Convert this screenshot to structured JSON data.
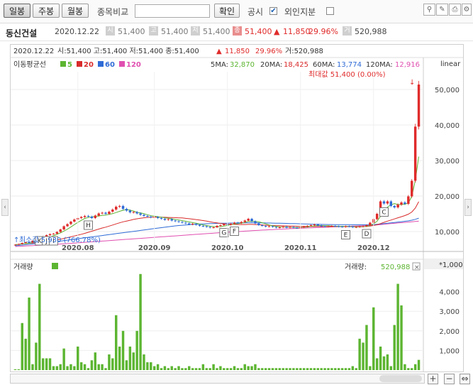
{
  "toolbar": {
    "day": "일봉",
    "week": "주봉",
    "month": "월봉",
    "compare_label": "종목비교",
    "compare_value": "",
    "confirm": "확인",
    "disclosure": "공시",
    "disclosure_check": "✔",
    "foreign": "외인지분",
    "foreign_check": ""
  },
  "info": {
    "name": "동신건설",
    "date": "2020.12.22",
    "open_icon": "시",
    "open": "51,400",
    "high_icon": "고",
    "high": "51,400",
    "low_icon": "저",
    "low": "51,400",
    "close_icon": "종",
    "close": "51,400",
    "change_arrow": "▲",
    "change": "11,850",
    "change_pct": "29.96%",
    "vol_icon": "거",
    "volume": "520,988"
  },
  "chart_header": {
    "date": "2020.12.22",
    "ohlc_text": "시:51,400  고:51,400  저:51,400  종:51,400",
    "arrow": "▲",
    "change": "11,850",
    "pct": "29.96%",
    "vol_text": "거:520,988"
  },
  "ma_legend": {
    "title": "이동평균선",
    "items": [
      {
        "label": "5",
        "color": "#5cb531"
      },
      {
        "label": "20",
        "color": "#d92b2b"
      },
      {
        "label": "60",
        "color": "#2f6bd6"
      },
      {
        "label": "120",
        "color": "#e04fb0"
      }
    ]
  },
  "ma_values": {
    "ma5_label": "5MA:",
    "ma5": "32,870",
    "ma20_label": "20MA:",
    "ma20": "18,425",
    "ma60_label": "60MA:",
    "ma60": "13,774",
    "ma120_label": "120MA:",
    "ma120": "12,916"
  },
  "scale_label": "linear",
  "max_label": "최대값 51,400 (0.00%)",
  "min_label": "최소값 5,930 (766.78%)",
  "volume_panel": {
    "title": "거래량",
    "value_label": "거래량:",
    "value": "520,988",
    "unit": "*1,000",
    "close": "×"
  },
  "colors": {
    "up": "#e02b2b",
    "down": "#2f6bd6",
    "volume": "#5cb531",
    "ma5": "#5cb531",
    "ma20": "#d92b2b",
    "ma60": "#2f6bd6",
    "ma120": "#e04fb0"
  },
  "chart_data": [
    {
      "type": "candlestick",
      "ylim": [
        5000,
        55000
      ],
      "yticks": [
        "10,000",
        "20,000",
        "30,000",
        "40,000",
        "50,000"
      ],
      "ytick_values": [
        10000,
        20000,
        30000,
        40000,
        50000
      ],
      "xticks": [
        "2020.08",
        "2020.09",
        "2020.10",
        "2020.11",
        "2020.12"
      ],
      "xtick_index": [
        18,
        40,
        61,
        82,
        103
      ],
      "events": [
        {
          "label": "K",
          "index": 7
        },
        {
          "label": "J",
          "index": 9
        },
        {
          "label": "I",
          "index": 11
        },
        {
          "label": "H",
          "index": 21
        },
        {
          "label": "G",
          "index": 60
        },
        {
          "label": "F",
          "index": 63
        },
        {
          "label": "E",
          "index": 95
        },
        {
          "label": "D",
          "index": 101
        },
        {
          "label": "C",
          "index": 106
        }
      ],
      "close": [
        6300,
        6500,
        6800,
        7000,
        6900,
        7400,
        7800,
        8200,
        8600,
        9000,
        9300,
        9400,
        9900,
        10600,
        11500,
        12100,
        12800,
        13400,
        13800,
        14100,
        14400,
        14200,
        13800,
        14500,
        15100,
        15300,
        15000,
        15600,
        16200,
        17000,
        17200,
        16400,
        15900,
        15400,
        15500,
        15100,
        14700,
        14400,
        14200,
        14000,
        14100,
        13800,
        13600,
        13300,
        13500,
        13100,
        12900,
        12700,
        12500,
        12300,
        12000,
        12200,
        11900,
        11600,
        11500,
        11300,
        11100,
        11200,
        11600,
        11800,
        12100,
        11900,
        12200,
        12500,
        12400,
        12700,
        13100,
        13600,
        12900,
        12300,
        11800,
        11600,
        11400,
        11500,
        11300,
        11100,
        11200,
        11400,
        11100,
        11300,
        11100,
        11000,
        11200,
        11400,
        11600,
        11800,
        12000,
        11700,
        11500,
        11400,
        11500,
        11600,
        11500,
        11400,
        11300,
        11500,
        11400,
        11200,
        11300,
        11400,
        11500,
        11800,
        12500,
        13500,
        15000,
        18500,
        17900,
        18500,
        17200,
        16800,
        17600,
        18200,
        17800,
        19900,
        24300,
        39550,
        51400
      ],
      "volume": [
        40,
        40,
        2400,
        1600,
        3700,
        300,
        1400,
        4400,
        600,
        600,
        600,
        200,
        200,
        300,
        1100,
        200,
        300,
        200,
        1200,
        400,
        300,
        100,
        500,
        900,
        300,
        300,
        100,
        800,
        600,
        2800,
        1200,
        2000,
        500,
        1200,
        900,
        2000,
        4900,
        800,
        400,
        400,
        200,
        300,
        100,
        200,
        100,
        200,
        100,
        200,
        100,
        100,
        200,
        100,
        100,
        100,
        300,
        100,
        100,
        300,
        100,
        200,
        100,
        100,
        100,
        200,
        100,
        100,
        300,
        200,
        200,
        300,
        100,
        100,
        100,
        100,
        100,
        100,
        100,
        100,
        100,
        100,
        100,
        100,
        100,
        100,
        100,
        100,
        100,
        100,
        100,
        100,
        100,
        100,
        100,
        100,
        100,
        100,
        100,
        200,
        100,
        1600,
        1400,
        2300,
        200,
        3200,
        600,
        1200,
        700,
        800,
        200,
        2300,
        4400,
        3300,
        300,
        100,
        100,
        300,
        521
      ],
      "ma5": [
        6300,
        6400,
        6533,
        6650,
        6700,
        6920,
        7180,
        7460,
        7780,
        8120,
        8480,
        8820,
        9220,
        9640,
        10140,
        10660,
        11280,
        11960,
        12580,
        13160,
        13700,
        13980,
        14140,
        14240,
        14400,
        14540,
        14640,
        14860,
        15040,
        15360,
        15700,
        16000,
        16240,
        16020,
        15780,
        15420,
        15280,
        15020,
        14740,
        14480,
        14340,
        14180,
        14040,
        13880,
        13780,
        13600,
        13400,
        13280,
        13080,
        12900,
        12700,
        12520,
        12340,
        12100,
        11880,
        11700,
        11520,
        11420,
        11360,
        11400,
        11560,
        11720,
        11940,
        12120,
        12260,
        12340,
        12560,
        12880,
        12900,
        12880,
        12760,
        12480,
        12160,
        11860,
        11600,
        11440,
        11360,
        11320,
        11260,
        11220,
        11160,
        11120,
        11160,
        11220,
        11260,
        11460,
        11600,
        11700,
        11700,
        11660,
        11640,
        11540,
        11500,
        11480,
        11460,
        11440,
        11440,
        11360,
        11340,
        11340,
        11360,
        11440,
        11720,
        12200,
        12900,
        14300,
        15600,
        16900,
        17500,
        17900,
        17600,
        17600,
        17700,
        18000,
        19900,
        24360,
        31090
      ],
      "ma20": [
        6300,
        6400,
        6533,
        6650,
        6700,
        6783,
        6886,
        7000,
        7133,
        7270,
        7400,
        7508,
        7638,
        7850,
        8070,
        8290,
        8520,
        8760,
        9000,
        9250,
        9500,
        9800,
        10100,
        10400,
        10700,
        11000,
        11250,
        11550,
        11840,
        12160,
        12470,
        12730,
        12970,
        13190,
        13410,
        13600,
        13750,
        13880,
        13980,
        14060,
        14080,
        14080,
        14060,
        14020,
        13990,
        13950,
        13910,
        13870,
        13830,
        13720,
        13620,
        13500,
        13380,
        13250,
        13100,
        12940,
        12760,
        12580,
        12430,
        12280,
        12180,
        12100,
        12040,
        12010,
        11980,
        11980,
        11990,
        12010,
        12020,
        11990,
        11930,
        11860,
        11800,
        11750,
        11700,
        11660,
        11630,
        11620,
        11600,
        11560,
        11540,
        11500,
        11470,
        11450,
        11430,
        11410,
        11420,
        11410,
        11400,
        11400,
        11400,
        11410,
        11400,
        11380,
        11370,
        11380,
        11380,
        11370,
        11370,
        11370,
        11400,
        11450,
        11560,
        11710,
        11920,
        12270,
        12600,
        12940,
        13240,
        13560,
        13880,
        14190,
        14500,
        14900,
        15500,
        16600,
        18425
      ],
      "ma60": [
        6000,
        6100,
        6200,
        6300,
        6400,
        6500,
        6600,
        6700,
        6800,
        6900,
        7000,
        7100,
        7200,
        7330,
        7460,
        7590,
        7720,
        7850,
        7980,
        8110,
        8240,
        8370,
        8500,
        8630,
        8760,
        8890,
        9020,
        9150,
        9280,
        9410,
        9540,
        9670,
        9800,
        9930,
        10060,
        10190,
        10320,
        10450,
        10580,
        10710,
        10840,
        10970,
        11100,
        11230,
        11360,
        11490,
        11600,
        11700,
        11790,
        11870,
        11940,
        12000,
        12060,
        12110,
        12160,
        12200,
        12240,
        12270,
        12300,
        12330,
        12360,
        12380,
        12400,
        12420,
        12440,
        12460,
        12470,
        12480,
        12490,
        12480,
        12460,
        12440,
        12420,
        12400,
        12380,
        12360,
        12340,
        12320,
        12300,
        12270,
        12240,
        12210,
        12180,
        12150,
        12120,
        12090,
        12060,
        12040,
        12020,
        12000,
        11990,
        11980,
        11970,
        11960,
        11950,
        11940,
        11930,
        11920,
        11910,
        11900,
        11900,
        11910,
        11930,
        11970,
        12030,
        12120,
        12230,
        12350,
        12460,
        12570,
        12680,
        12790,
        12900,
        13020,
        13200,
        13450,
        13774
      ],
      "ma120": [
        5800,
        5850,
        5900,
        5950,
        6000,
        6050,
        6100,
        6150,
        6200,
        6260,
        6320,
        6380,
        6440,
        6500,
        6560,
        6620,
        6690,
        6760,
        6830,
        6900,
        6970,
        7040,
        7110,
        7180,
        7250,
        7320,
        7390,
        7460,
        7530,
        7600,
        7670,
        7740,
        7810,
        7880,
        7950,
        8020,
        8090,
        8160,
        8230,
        8300,
        8370,
        8440,
        8510,
        8580,
        8650,
        8720,
        8790,
        8860,
        8930,
        9000,
        9070,
        9140,
        9210,
        9280,
        9350,
        9420,
        9490,
        9560,
        9630,
        9700,
        9760,
        9820,
        9880,
        9940,
        10000,
        10060,
        10120,
        10180,
        10240,
        10300,
        10360,
        10410,
        10460,
        10510,
        10560,
        10610,
        10660,
        10710,
        10760,
        10810,
        10860,
        10900,
        10940,
        10980,
        11020,
        11060,
        11100,
        11140,
        11180,
        11220,
        11260,
        11300,
        11340,
        11380,
        11420,
        11460,
        11500,
        11540,
        11580,
        11620,
        11660,
        11700,
        11750,
        11810,
        11880,
        11960,
        12050,
        12140,
        12230,
        12320,
        12410,
        12500,
        12590,
        12680,
        12760,
        12840,
        12916
      ]
    }
  ]
}
